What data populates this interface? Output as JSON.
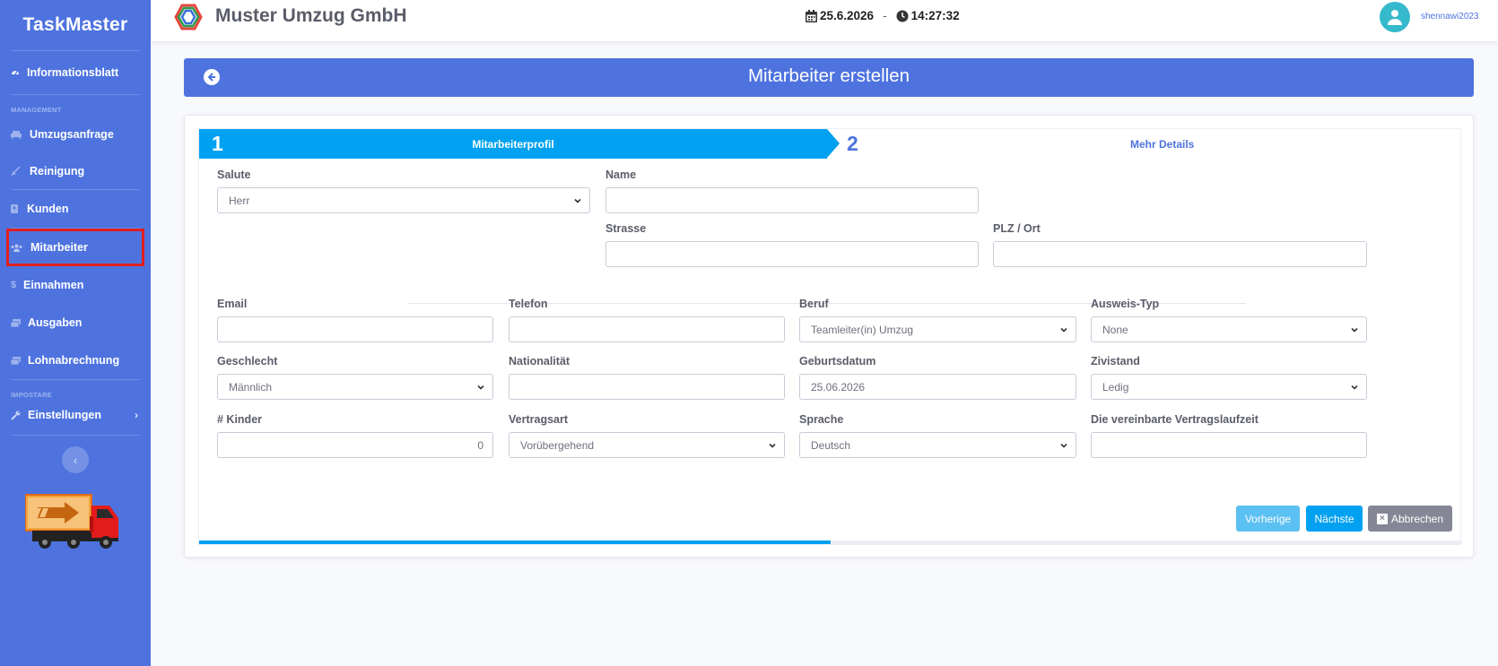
{
  "sidebar": {
    "brand": "TaskMaster",
    "dashboard": "Informationsblatt",
    "heading_management": "MANAGEMENT",
    "items": [
      {
        "label": "Umzugsanfrage"
      },
      {
        "label": "Reinigung"
      },
      {
        "label": "Kunden"
      },
      {
        "label": "Mitarbeiter"
      },
      {
        "label": "Einnahmen"
      },
      {
        "label": "Ausgaben"
      },
      {
        "label": "Lohnabrechnung"
      }
    ],
    "heading_settings": "IMPOSTARE",
    "settings": "Einstellungen",
    "toggle_icon": "‹"
  },
  "topbar": {
    "company": "Muster Umzug GmbH",
    "date": "25.6.2026",
    "separator": "-",
    "time": "14:27:32",
    "username": "shennawi2023"
  },
  "banner": {
    "title": "Mitarbeiter erstellen"
  },
  "wizard": {
    "step1_number": "1",
    "step1_label": "Mitarbeiterprofil",
    "step2_number": "2",
    "step2_label": "Mehr Details",
    "progress": 0.5
  },
  "form": {
    "salute_label": "Salute",
    "salute_value": "Herr",
    "name_label": "Name",
    "strasse_label": "Strasse",
    "plz_label": "PLZ / Ort",
    "email_label": "Email",
    "telefon_label": "Telefon",
    "beruf_label": "Beruf",
    "beruf_value": "Teamleiter(in) Umzug",
    "ausweis_label": "Ausweis-Typ",
    "ausweis_value": "None",
    "geschlecht_label": "Geschlecht",
    "geschlecht_value": "Männlich",
    "nationalitaet_label": "Nationalität",
    "geburtsdatum_label": "Geburtsdatum",
    "geburtsdatum_value": "25.06.2026",
    "zivistand_label": "Zivistand",
    "zivistand_value": "Ledig",
    "kinder_label": "# Kinder",
    "kinder_value": "0",
    "vertragsart_label": "Vertragsart",
    "vertragsart_value": "Vorübergehend",
    "sprache_label": "Sprache",
    "sprache_value": "Deutsch",
    "laufzeit_label": "Die vereinbarte Vertragslaufzeit"
  },
  "buttons": {
    "prev": "Vorherige",
    "next": "Nächste",
    "cancel": "Abbrechen"
  },
  "colors": {
    "sidebar": "#4e73df",
    "wizard_active": "#00a1f0",
    "highlight": "#e01e1e"
  }
}
